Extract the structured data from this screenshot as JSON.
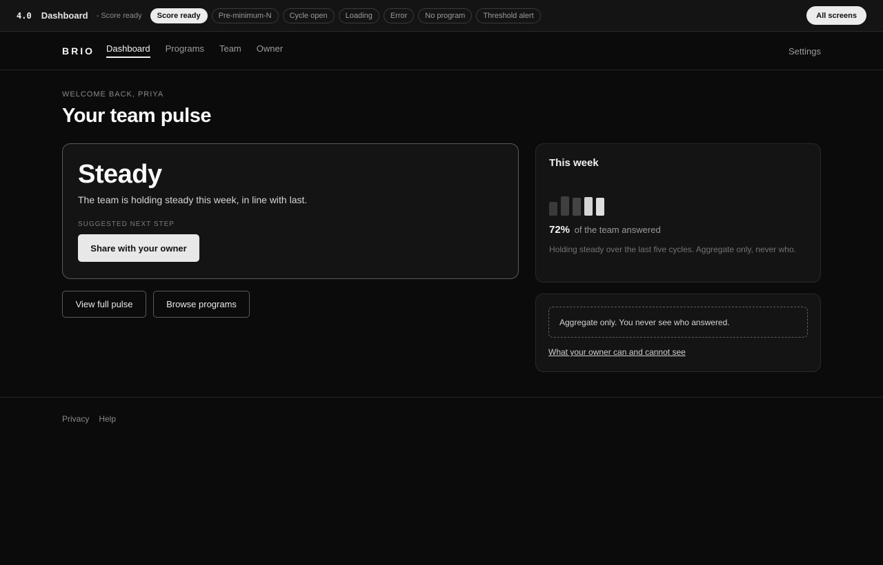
{
  "devbar": {
    "version": "4.0",
    "screen": "Dashboard",
    "state": "- Score ready",
    "pills": [
      "Score ready",
      "Pre-minimum-N",
      "Cycle open",
      "Loading",
      "Error",
      "No program",
      "Threshold alert"
    ],
    "active_pill": "Score ready",
    "all_screens": "All screens"
  },
  "nav": {
    "logo": "BRIO",
    "links": [
      "Dashboard",
      "Programs",
      "Team",
      "Owner"
    ],
    "active": "Dashboard",
    "settings": "Settings"
  },
  "header": {
    "welcome": "WELCOME BACK, PRIYA",
    "title": "Your team pulse"
  },
  "pulse": {
    "status": "Steady",
    "description": "The team is holding steady this week, in line with last.",
    "next_step_label": "SUGGESTED NEXT STEP",
    "primary_action": "Share with your owner",
    "secondary_actions": [
      "View full pulse",
      "Browse programs"
    ]
  },
  "week": {
    "title": "This week",
    "trend": [
      {
        "level": 0.67,
        "color": "#3a3a3a"
      },
      {
        "level": 0.93,
        "color": "#3f3f3f"
      },
      {
        "level": 0.87,
        "color": "#444444"
      },
      {
        "level": 0.9,
        "color": "#d4d4d4"
      },
      {
        "level": 0.87,
        "color": "#dedede"
      }
    ],
    "percent": "72%",
    "percent_suffix": "of the team answered",
    "note": "Holding steady over the last five cycles. Aggregate only, never who."
  },
  "privacy": {
    "notice": "Aggregate only. You never see who answered.",
    "link": "What your owner can and cannot see"
  },
  "footer": {
    "links": [
      "Privacy",
      "Help"
    ]
  }
}
